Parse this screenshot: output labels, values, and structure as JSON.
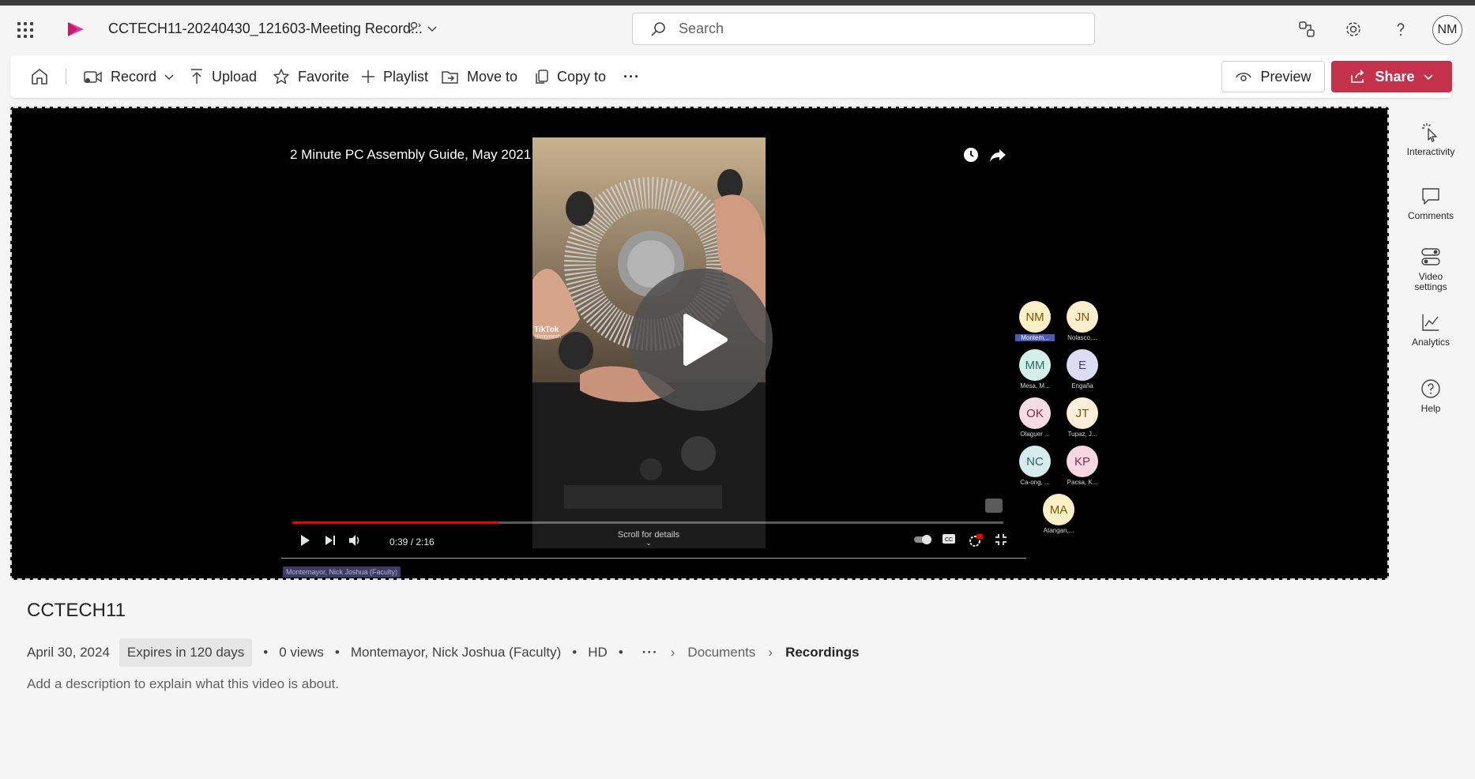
{
  "header": {
    "file_title": "CCTECH11-20240430_121603-Meeting Record...",
    "search_placeholder": "Search",
    "user_initials": "NM"
  },
  "toolbar": {
    "record": "Record",
    "upload": "Upload",
    "favorite": "Favorite",
    "playlist": "Playlist",
    "move_to": "Move to",
    "copy_to": "Copy to",
    "more": "···",
    "preview": "Preview",
    "share": "Share"
  },
  "player": {
    "video_title": "2 Minute PC Assembly Guide, May 2021",
    "tiktok_label": "TikTok",
    "tiktok_handle": "@mryeesh",
    "timecode": "0:39 / 2:16",
    "progress": 0.29,
    "scroll_hint": "Scroll for details",
    "speaker_tag": "Montemayor, Nick Joshua (Faculty)",
    "participants": [
      {
        "initials": "NM",
        "name": "Montem...",
        "bg": "#fdf0c6",
        "fg": "#7a5a00",
        "highlight": true
      },
      {
        "initials": "JN",
        "name": "Nolasco,...",
        "bg": "#fbefd0",
        "fg": "#7a5a00",
        "highlight": false
      },
      {
        "initials": "MM",
        "name": "Mesa, M...",
        "bg": "#d4efe8",
        "fg": "#2c6b5e",
        "highlight": false
      },
      {
        "initials": "E",
        "name": "Engaña",
        "bg": "#dcdcf2",
        "fg": "#3d3d80",
        "highlight": false
      },
      {
        "initials": "OK",
        "name": "Olaguer ...",
        "bg": "#f5dce4",
        "fg": "#7a2e4a",
        "highlight": false
      },
      {
        "initials": "JT",
        "name": "Tupaz, J...",
        "bg": "#fbefd9",
        "fg": "#7a5a00",
        "highlight": false
      },
      {
        "initials": "NC",
        "name": "Ca-ong, ...",
        "bg": "#d6ecec",
        "fg": "#2c6363",
        "highlight": false
      },
      {
        "initials": "KP",
        "name": "Pacsa, K...",
        "bg": "#f8d7e2",
        "fg": "#8a2c50",
        "highlight": false
      },
      {
        "initials": "MA",
        "name": "Atangan,...",
        "bg": "#fdf0c6",
        "fg": "#7a5a00",
        "highlight": false
      }
    ]
  },
  "rail": {
    "interactivity": "Interactivity",
    "comments": "Comments",
    "video_settings_1": "Video",
    "video_settings_2": "settings",
    "analytics": "Analytics",
    "help": "Help"
  },
  "details": {
    "heading": "CCTECH11",
    "date": "April 30, 2024",
    "expires": "Expires in 120 days",
    "views": "0 views",
    "owner": "Montemayor, Nick Joshua (Faculty)",
    "quality": "HD",
    "more": "···",
    "crumb_1": "Documents",
    "crumb_2": "Recordings",
    "description_placeholder": "Add a description to explain what this video is about."
  },
  "colors": {
    "brand_accent": "#c4314b",
    "progress_red": "#e00000"
  }
}
